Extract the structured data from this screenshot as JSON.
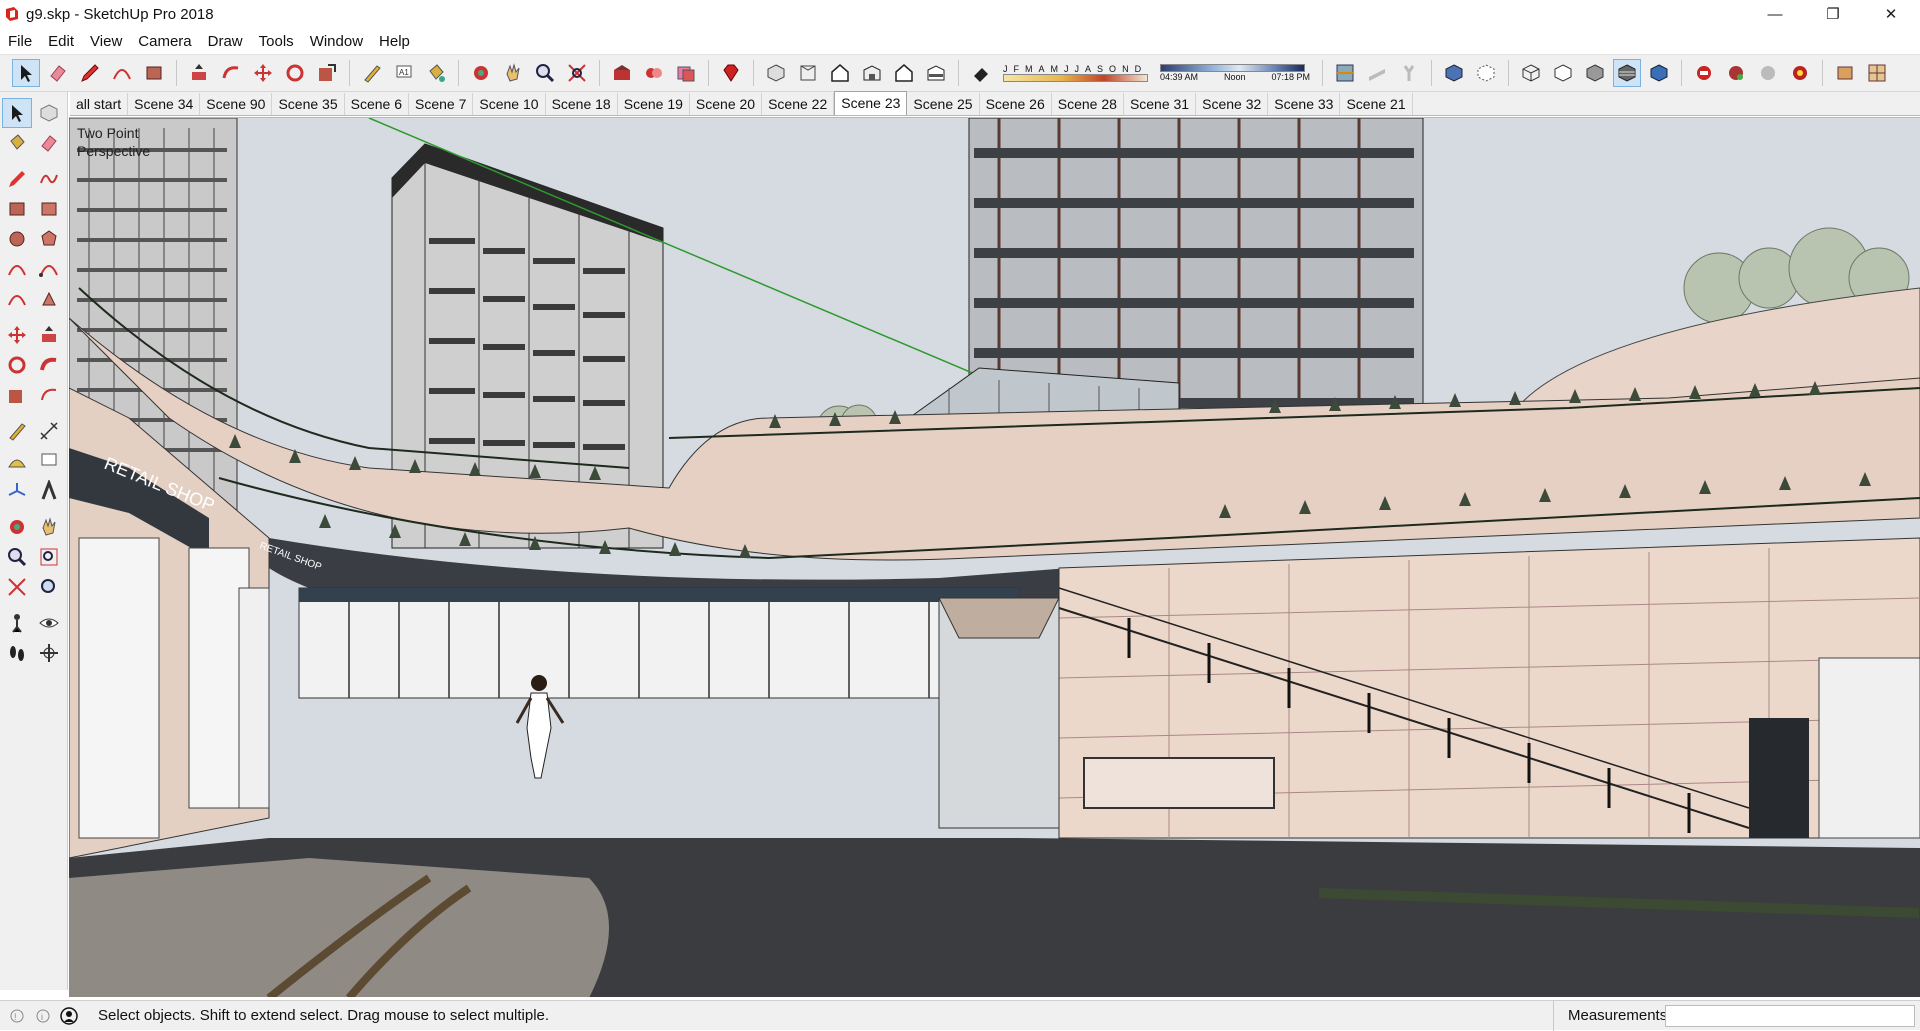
{
  "window": {
    "title": "g9.skp - SketchUp Pro 2018",
    "minimize_glyph": "—",
    "restore_glyph": "❐",
    "close_glyph": "✕"
  },
  "menu": [
    "File",
    "Edit",
    "View",
    "Camera",
    "Draw",
    "Tools",
    "Window",
    "Help"
  ],
  "shadow_settings": {
    "months": [
      "J",
      "F",
      "M",
      "A",
      "M",
      "J",
      "J",
      "A",
      "S",
      "O",
      "N",
      "D"
    ],
    "time_start": "04:39 AM",
    "time_mid": "Noon",
    "time_end": "07:18 PM"
  },
  "scenes": {
    "tabs": [
      "all start",
      "Scene 34",
      "Scene 90",
      "Scene 35",
      "Scene 6",
      "Scene 7",
      "Scene 10",
      "Scene 18",
      "Scene 19",
      "Scene 20",
      "Scene 22",
      "Scene 23",
      "Scene 25",
      "Scene 26",
      "Scene 28",
      "Scene 31",
      "Scene 32",
      "Scene 33",
      "Scene 21"
    ],
    "active": "Scene 23"
  },
  "viewport": {
    "camera_label_line1": "Two Point",
    "camera_label_line2": "Perspective",
    "signage_left": "RETAIL SHOP",
    "signage_small": "RETAIL SHOP"
  },
  "status": {
    "message": "Select objects. Shift to extend select. Drag mouse to select multiple.",
    "measurements_label": "Measurements",
    "measurements_value": ""
  },
  "colors": {
    "accent_select": "#cfe3f7",
    "sky": "#d4dbe1",
    "facade_pink": "#e9d3c7",
    "road": "#3a3b3f"
  }
}
